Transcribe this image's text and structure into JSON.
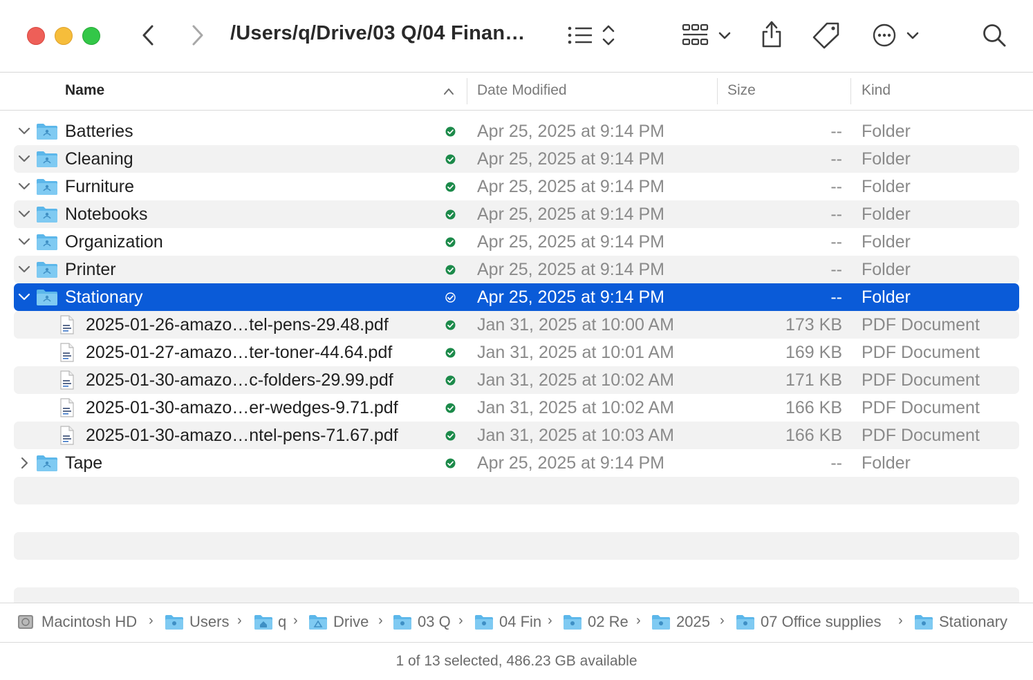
{
  "window": {
    "title": "/Users/q/Drive/03 Q/04 Finan…"
  },
  "columns": {
    "name": "Name",
    "date": "Date Modified",
    "size": "Size",
    "kind": "Kind"
  },
  "rows": [
    {
      "name": "Batteries",
      "date": "Apr 25, 2025 at 9:14 PM",
      "size": "--",
      "kind": "Folder"
    },
    {
      "name": "Cleaning",
      "date": "Apr 25, 2025 at 9:14 PM",
      "size": "--",
      "kind": "Folder"
    },
    {
      "name": "Furniture",
      "date": "Apr 25, 2025 at 9:14 PM",
      "size": "--",
      "kind": "Folder"
    },
    {
      "name": "Notebooks",
      "date": "Apr 25, 2025 at 9:14 PM",
      "size": "--",
      "kind": "Folder"
    },
    {
      "name": "Organization",
      "date": "Apr 25, 2025 at 9:14 PM",
      "size": "--",
      "kind": "Folder"
    },
    {
      "name": "Printer",
      "date": "Apr 25, 2025 at 9:14 PM",
      "size": "--",
      "kind": "Folder"
    },
    {
      "name": "Stationary",
      "date": "Apr 25, 2025 at 9:14 PM",
      "size": "--",
      "kind": "Folder"
    },
    {
      "name": "2025-01-26-amazo…tel-pens-29.48.pdf",
      "date": "Jan 31, 2025 at 10:00 AM",
      "size": "173 KB",
      "kind": "PDF Document"
    },
    {
      "name": "2025-01-27-amazo…ter-toner-44.64.pdf",
      "date": "Jan 31, 2025 at 10:01 AM",
      "size": "169 KB",
      "kind": "PDF Document"
    },
    {
      "name": "2025-01-30-amazo…c-folders-29.99.pdf",
      "date": "Jan 31, 2025 at 10:02 AM",
      "size": "171 KB",
      "kind": "PDF Document"
    },
    {
      "name": "2025-01-30-amazo…er-wedges-9.71.pdf",
      "date": "Jan 31, 2025 at 10:02 AM",
      "size": "166 KB",
      "kind": "PDF Document"
    },
    {
      "name": "2025-01-30-amazo…ntel-pens-71.67.pdf",
      "date": "Jan 31, 2025 at 10:03 AM",
      "size": "166 KB",
      "kind": "PDF Document"
    },
    {
      "name": "Tape",
      "date": "Apr 25, 2025 at 9:14 PM",
      "size": "--",
      "kind": "Folder"
    }
  ],
  "pathbar": [
    "Macintosh HD",
    "Users",
    "q",
    "Drive",
    "03 Q",
    "04 Fin",
    "02 Re",
    "2025",
    "07 Office supplies",
    "Stationary"
  ],
  "status": "1 of 13 selected, 486.23 GB available",
  "colors": {
    "selection": "#0a5bd8",
    "folder": "#5cb7ea",
    "sync": "#1c8a4a"
  }
}
